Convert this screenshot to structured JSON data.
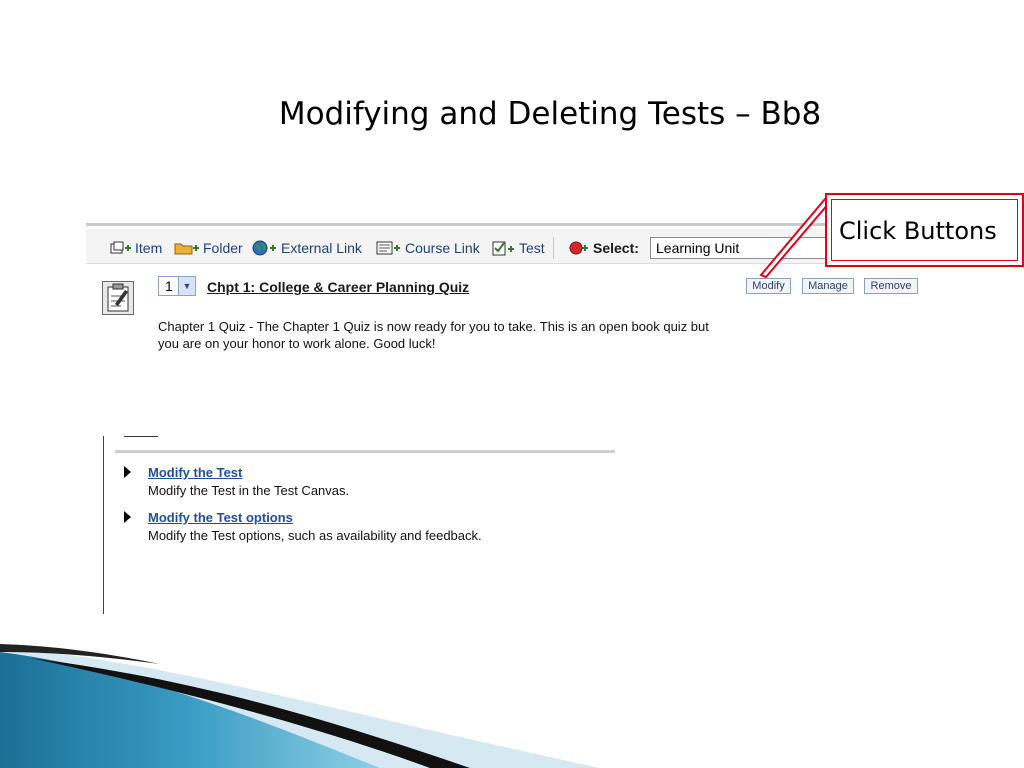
{
  "slide": {
    "title": "Modifying and Deleting Tests – Bb8"
  },
  "toolbar": {
    "items": [
      {
        "label": "Item",
        "icon": "add-item-icon"
      },
      {
        "label": "Folder",
        "icon": "add-folder-icon"
      },
      {
        "label": "External Link",
        "icon": "globe-icon"
      },
      {
        "label": "Course Link",
        "icon": "course-link-icon"
      },
      {
        "label": "Test",
        "icon": "test-icon"
      }
    ],
    "select_label": "Select:",
    "select_value": "Learning Unit"
  },
  "callout": {
    "text": "Click Buttons",
    "color": "#e2001a"
  },
  "content_item": {
    "order": "1",
    "title": "Chpt 1: College & Career Planning Quiz",
    "description": "Chapter 1 Quiz - The Chapter 1 Quiz is now ready for you to take. This is an open book quiz but you are on your honor to work alone. Good luck!",
    "buttons": {
      "modify": "Modify",
      "manage": "Manage",
      "remove": "Remove"
    }
  },
  "modify_menu": {
    "options": [
      {
        "link": "Modify the Test",
        "desc": "Modify the Test in the Test Canvas."
      },
      {
        "link": "Modify the Test options",
        "desc": "Modify the Test options, such as availability and feedback."
      }
    ]
  }
}
